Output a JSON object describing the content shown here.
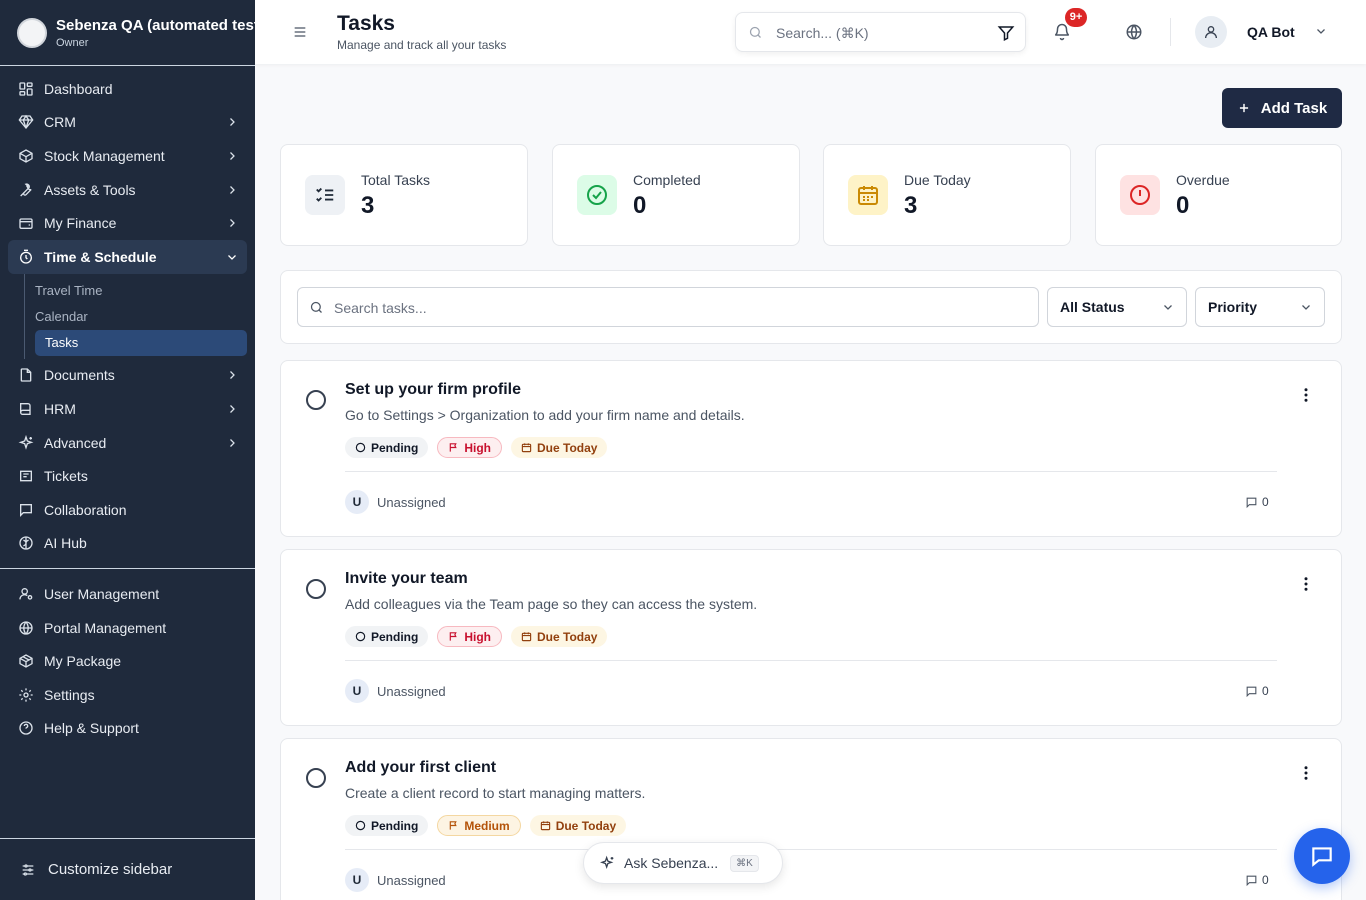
{
  "org": {
    "name": "Sebenza QA (automated tests)",
    "role": "Owner"
  },
  "sidebar": {
    "items": [
      {
        "label": "Dashboard",
        "icon": "dashboard-icon",
        "has_chevron": false
      },
      {
        "label": "CRM",
        "icon": "gem-icon",
        "has_chevron": true
      },
      {
        "label": "Stock Management",
        "icon": "box-icon",
        "has_chevron": true
      },
      {
        "label": "Assets & Tools",
        "icon": "wrench-icon",
        "has_chevron": true
      },
      {
        "label": "My Finance",
        "icon": "wallet-icon",
        "has_chevron": true
      },
      {
        "label": "Time & Schedule",
        "icon": "clock-icon",
        "has_chevron": true,
        "expanded": true
      }
    ],
    "sub_items": [
      {
        "label": "Travel Time"
      },
      {
        "label": "Calendar"
      },
      {
        "label": "Tasks",
        "active": true
      }
    ],
    "items_after": [
      {
        "label": "Documents",
        "icon": "document-icon",
        "has_chevron": true
      },
      {
        "label": "HRM",
        "icon": "book-icon",
        "has_chevron": true
      },
      {
        "label": "Advanced",
        "icon": "sparkle-icon",
        "has_chevron": true
      },
      {
        "label": "Tickets",
        "icon": "ticket-icon",
        "has_chevron": false
      },
      {
        "label": "Collaboration",
        "icon": "message-icon",
        "has_chevron": false
      },
      {
        "label": "AI Hub",
        "icon": "brain-icon",
        "has_chevron": false
      }
    ],
    "admin_items": [
      {
        "label": "User Management",
        "icon": "user-cog-icon"
      },
      {
        "label": "Portal Management",
        "icon": "globe-icon"
      },
      {
        "label": "My Package",
        "icon": "package-icon"
      },
      {
        "label": "Settings",
        "icon": "gear-icon"
      },
      {
        "label": "Help & Support",
        "icon": "help-icon"
      }
    ],
    "customize_label": "Customize sidebar"
  },
  "header": {
    "title": "Tasks",
    "subtitle": "Manage and track all your tasks",
    "search_placeholder": "Search... (⌘K)",
    "notification_badge": "9+",
    "user_name": "QA Bot"
  },
  "actions": {
    "add_task_label": "Add Task"
  },
  "stats": [
    {
      "label": "Total Tasks",
      "value": "3",
      "icon": "list-check-icon",
      "color": "#4b5563",
      "bg": "#eef1f5"
    },
    {
      "label": "Completed",
      "value": "0",
      "icon": "check-circle-icon",
      "color": "#16a34a",
      "bg": "#dcfce7"
    },
    {
      "label": "Due Today",
      "value": "3",
      "icon": "calendar-icon",
      "color": "#ca8a04",
      "bg": "#fef3c7"
    },
    {
      "label": "Overdue",
      "value": "0",
      "icon": "alert-circle-icon",
      "color": "#dc2626",
      "bg": "#fee2e2"
    }
  ],
  "filters": {
    "search_placeholder": "Search tasks...",
    "status_label": "All Status",
    "priority_label": "Priority"
  },
  "tasks": [
    {
      "title": "Set up your firm profile",
      "description": "Go to Settings > Organization to add your firm name and details.",
      "status": "Pending",
      "priority": "High",
      "due": "Due Today",
      "assignee_initial": "U",
      "assignee": "Unassigned",
      "comments": "0"
    },
    {
      "title": "Invite your team",
      "description": "Add colleagues via the Team page so they can access the system.",
      "status": "Pending",
      "priority": "High",
      "due": "Due Today",
      "assignee_initial": "U",
      "assignee": "Unassigned",
      "comments": "0"
    },
    {
      "title": "Add your first client",
      "description": "Create a client record to start managing matters.",
      "status": "Pending",
      "priority": "Medium",
      "due": "Due Today",
      "assignee_initial": "U",
      "assignee": "Unassigned",
      "comments": "0"
    }
  ],
  "assistant": {
    "label": "Ask Sebenza...",
    "shortcut": "⌘K"
  },
  "colors": {
    "sidebar_bg": "#1f2a3c",
    "primary": "#1f2a44",
    "accent": "#2563eb",
    "danger": "#dc2626"
  }
}
